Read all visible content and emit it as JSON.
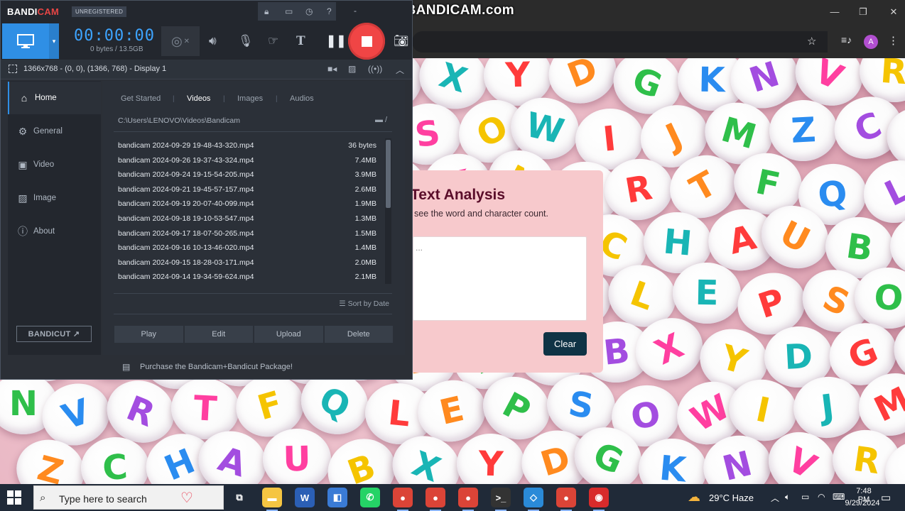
{
  "browser": {
    "watermark": "www.BANDICAM.com",
    "min_glyph": "—",
    "max_glyph": "❐",
    "close_glyph": "✕",
    "profile_initial": "A"
  },
  "page": {
    "title": "Text Analysis",
    "subtitle": "see the word and character count.",
    "textarea_placeholder": "...",
    "clear_label": "Clear"
  },
  "bandicam": {
    "logo_a": "BANDI",
    "logo_b": "CAM",
    "unregistered": "UNREGISTERED",
    "timer": "00:00:00",
    "size": "0 bytes / 13.5GB",
    "target": "1366x768 - (0, 0), (1366, 768) - Display 1",
    "nav": [
      {
        "label": "Home",
        "icon": "home-icon",
        "glyph": "⌂"
      },
      {
        "label": "General",
        "icon": "gear-icon",
        "glyph": "⚙"
      },
      {
        "label": "Video",
        "icon": "video-icon",
        "glyph": "▣"
      },
      {
        "label": "Image",
        "icon": "image-icon",
        "glyph": "▨"
      },
      {
        "label": "About",
        "icon": "info-icon",
        "glyph": "ⓘ"
      }
    ],
    "tabs": [
      "Get Started",
      "Videos",
      "Images",
      "Audios"
    ],
    "active_tab": "Videos",
    "path": "C:\\Users\\LENOVO\\Videos\\Bandicam",
    "files": [
      {
        "name": "bandicam 2024-09-29 19-48-43-320.mp4",
        "size": "36 bytes"
      },
      {
        "name": "bandicam 2024-09-26 19-37-43-324.mp4",
        "size": "7.4MB"
      },
      {
        "name": "bandicam 2024-09-24 19-15-54-205.mp4",
        "size": "3.9MB"
      },
      {
        "name": "bandicam 2024-09-21 19-45-57-157.mp4",
        "size": "2.6MB"
      },
      {
        "name": "bandicam 2024-09-19 20-07-40-099.mp4",
        "size": "1.9MB"
      },
      {
        "name": "bandicam 2024-09-18 19-10-53-547.mp4",
        "size": "1.3MB"
      },
      {
        "name": "bandicam 2024-09-17 18-07-50-265.mp4",
        "size": "1.5MB"
      },
      {
        "name": "bandicam 2024-09-16 10-13-46-020.mp4",
        "size": "1.4MB"
      },
      {
        "name": "bandicam 2024-09-15 18-28-03-171.mp4",
        "size": "2.0MB"
      },
      {
        "name": "bandicam 2024-09-14 19-34-59-624.mp4",
        "size": "2.1MB"
      }
    ],
    "sort_label": "Sort by Date",
    "actions": [
      "Play",
      "Edit",
      "Upload",
      "Delete"
    ],
    "bandicut_label": "BANDICUT ↗",
    "promo": "Purchase the Bandicam+Bandicut Package!"
  },
  "taskbar": {
    "search_placeholder": "Type here to search",
    "weather": "29°C  Haze",
    "time": "7:48 PM",
    "date": "9/29/2024",
    "apps": [
      {
        "name": "task-view",
        "glyph": "⧉",
        "color": "transparent"
      },
      {
        "name": "file-explorer",
        "glyph": "▬",
        "color": "#f5c542"
      },
      {
        "name": "word",
        "glyph": "W",
        "color": "#2b5fb5"
      },
      {
        "name": "microsoft-store",
        "glyph": "◧",
        "color": "#3a7bd5"
      },
      {
        "name": "whatsapp",
        "glyph": "✆",
        "color": "#25d366"
      },
      {
        "name": "chrome-profile",
        "glyph": "●",
        "color": "#db4437"
      },
      {
        "name": "chrome",
        "glyph": "●",
        "color": "#db4437"
      },
      {
        "name": "chrome-2",
        "glyph": "●",
        "color": "#db4437"
      },
      {
        "name": "terminal",
        "glyph": ">_",
        "color": "#333"
      },
      {
        "name": "vscode",
        "glyph": "◇",
        "color": "#2a8ad8"
      },
      {
        "name": "chrome-3",
        "glyph": "●",
        "color": "#db4437"
      },
      {
        "name": "bandicam",
        "glyph": "◉",
        "color": "#d82b2b"
      }
    ]
  },
  "colors": {
    "accent": "#2f8fe5",
    "record": "#f04545",
    "card_bg": "#f7c9cc",
    "clear_btn": "#0f3345"
  }
}
